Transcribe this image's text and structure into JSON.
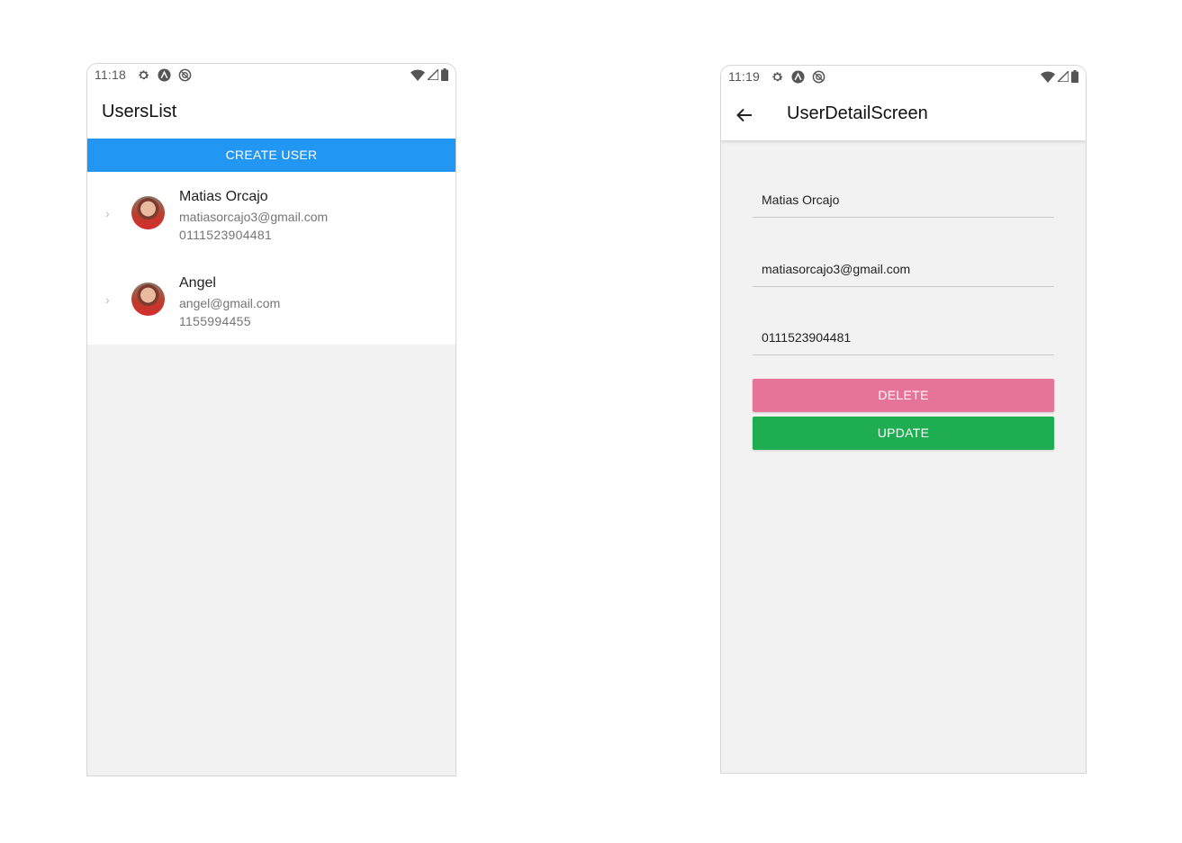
{
  "colors": {
    "primary_blue": "#2196f3",
    "delete_pink": "#e57498",
    "update_green": "#1fad52",
    "screen_bg": "#f2f2f2"
  },
  "left_screen": {
    "status_bar": {
      "time": "11:18",
      "left_icons": [
        "gear-icon",
        "expo-icon",
        "sync-icon"
      ],
      "right_icons": [
        "wifi-icon",
        "signal-icon",
        "battery-icon"
      ]
    },
    "app_bar": {
      "title": "UsersList"
    },
    "create_button": {
      "label": "CREATE USER"
    },
    "users": [
      {
        "name": "Matias Orcajo",
        "email": "matiasorcajo3@gmail.com",
        "phone": "0111523904481"
      },
      {
        "name": "Angel",
        "email": "angel@gmail.com",
        "phone": "1155994455"
      }
    ]
  },
  "right_screen": {
    "status_bar": {
      "time": "11:19",
      "left_icons": [
        "gear-icon",
        "expo-icon",
        "sync-icon"
      ],
      "right_icons": [
        "wifi-icon",
        "signal-icon",
        "battery-icon"
      ]
    },
    "app_bar": {
      "title": "UserDetailScreen",
      "back_icon": "arrow-left-icon"
    },
    "form": {
      "name_value": "Matias Orcajo",
      "email_value": "matiasorcajo3@gmail.com",
      "phone_value": "0111523904481"
    },
    "delete_button": {
      "label": "DELETE"
    },
    "update_button": {
      "label": "UPDATE"
    }
  }
}
